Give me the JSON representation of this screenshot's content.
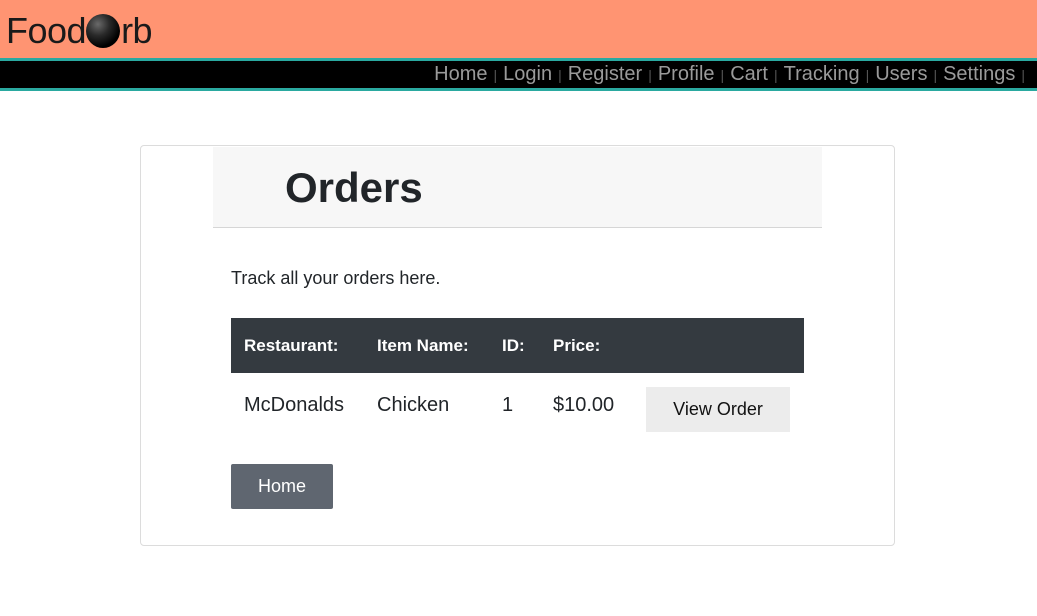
{
  "brand": {
    "prefix": "Food",
    "suffix": "rb",
    "orb_icon": "black-orb-icon"
  },
  "colors": {
    "topbar": "#ff9472",
    "accent": "#2aa9a0",
    "navbar": "#000000",
    "table_header": "#343a40",
    "home_button": "#5f6670"
  },
  "nav": {
    "items": [
      {
        "label": "Home"
      },
      {
        "label": "Login"
      },
      {
        "label": "Register"
      },
      {
        "label": "Profile"
      },
      {
        "label": "Cart"
      },
      {
        "label": "Tracking"
      },
      {
        "label": "Users"
      },
      {
        "label": "Settings"
      }
    ],
    "separator": "|"
  },
  "page": {
    "title": "Orders",
    "description": "Track all your orders here.",
    "table": {
      "headers": [
        "Restaurant:",
        "Item Name:",
        "ID:",
        "Price:",
        ""
      ],
      "rows": [
        {
          "restaurant": "McDonalds",
          "item": "Chicken",
          "id": "1",
          "price": "$10.00",
          "action": "View Order"
        }
      ]
    },
    "home_button": "Home"
  }
}
